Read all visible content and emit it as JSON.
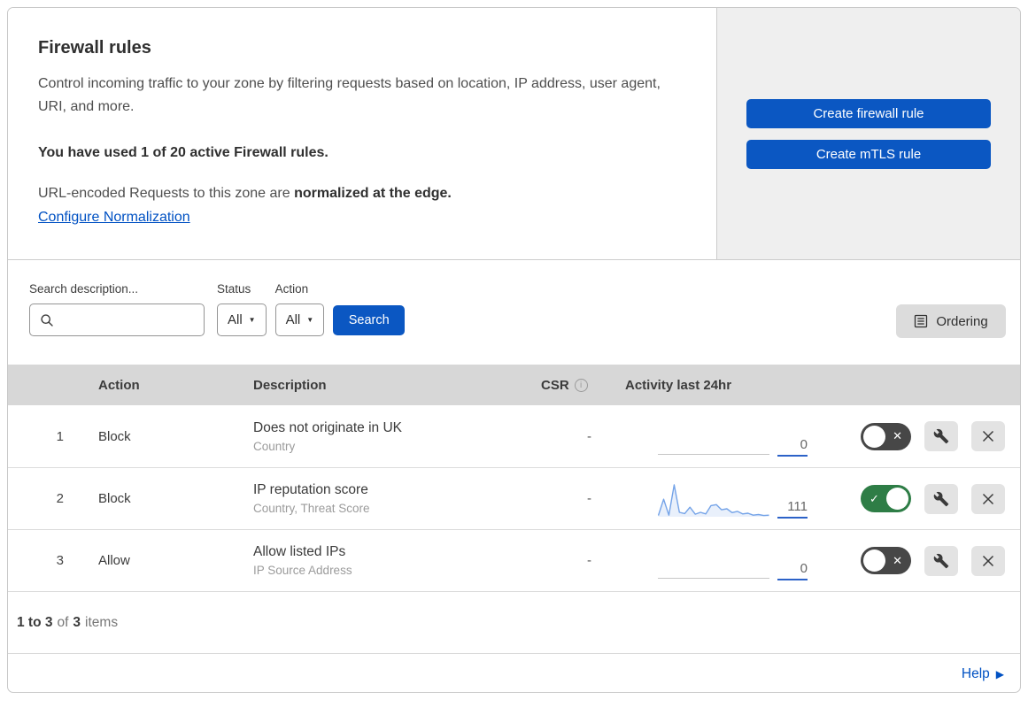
{
  "intro": {
    "title": "Firewall rules",
    "description": "Control incoming traffic to your zone by filtering requests based on location, IP address, user agent, URI, and more.",
    "usage": "You have used 1 of 20 active Firewall rules.",
    "normalization_prefix": "URL-encoded Requests to this zone are ",
    "normalization_bold": "normalized at the edge.",
    "configure_link": "Configure Normalization"
  },
  "actions": {
    "create_firewall_rule": "Create firewall rule",
    "create_mtls_rule": "Create mTLS rule"
  },
  "filters": {
    "search_label": "Search description...",
    "status_label": "Status",
    "status_value": "All",
    "action_label": "Action",
    "action_value": "All",
    "search_button": "Search",
    "ordering_button": "Ordering"
  },
  "table": {
    "headers": {
      "action": "Action",
      "description": "Description",
      "csr": "CSR",
      "activity": "Activity last 24hr"
    },
    "rows": [
      {
        "number": "1",
        "action": "Block",
        "title": "Does not originate in UK",
        "subtitle": "Country",
        "csr": "-",
        "activity_count": "0",
        "enabled": false,
        "sparkline": "flat"
      },
      {
        "number": "2",
        "action": "Block",
        "title": "IP reputation score",
        "subtitle": "Country, Threat Score",
        "csr": "-",
        "activity_count": "111",
        "enabled": true,
        "sparkline": "line",
        "sparkline_values": [
          0.04,
          0.55,
          0.05,
          1.0,
          0.14,
          0.1,
          0.3,
          0.08,
          0.14,
          0.09,
          0.35,
          0.38,
          0.22,
          0.25,
          0.13,
          0.17,
          0.09,
          0.11,
          0.05,
          0.07,
          0.04,
          0.05
        ]
      },
      {
        "number": "3",
        "action": "Allow",
        "title": "Allow listed IPs",
        "subtitle": "IP Source Address",
        "csr": "-",
        "activity_count": "0",
        "enabled": false,
        "sparkline": "flat"
      }
    ]
  },
  "footer": {
    "range": "1 to 3",
    "of": "of",
    "total": "3",
    "items": "items"
  },
  "help": {
    "label": "Help"
  },
  "icons": {
    "info_glyph": "i",
    "caret_glyph": "▼",
    "toggle_off_glyph": "✕",
    "toggle_on_glyph": "✓",
    "help_arrow_glyph": "▶"
  },
  "colors": {
    "accent_blue": "#0b57c2",
    "link_blue": "#0051c3",
    "toggle_on_green": "#2e7d46",
    "toggle_off_grey": "#474747",
    "sparkline_blue": "#74a3e8",
    "panel_grey": "#efefef",
    "table_header_grey": "#d7d7d7"
  }
}
